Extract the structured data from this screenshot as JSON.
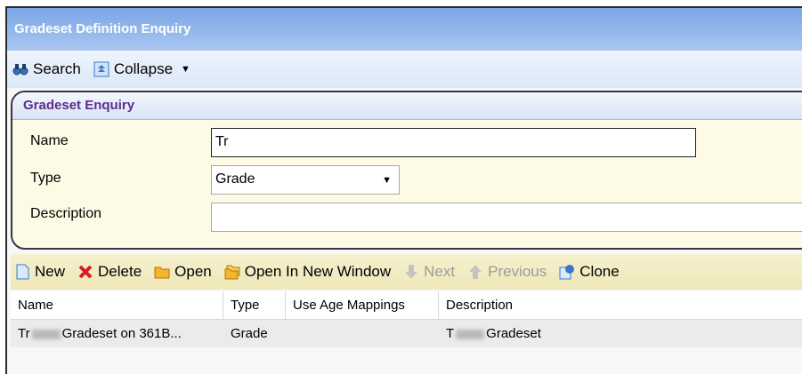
{
  "window": {
    "title": "Gradeset Definition Enquiry"
  },
  "toolbar": {
    "search_label": "Search",
    "collapse_label": "Collapse"
  },
  "panel": {
    "title": "Gradeset Enquiry",
    "name_label": "Name",
    "name_value": "Tr",
    "type_label": "Type",
    "type_value": "Grade",
    "description_label": "Description",
    "description_value": ""
  },
  "actions": {
    "new": "New",
    "delete": "Delete",
    "open": "Open",
    "open_new_window": "Open In New Window",
    "next": "Next",
    "previous": "Previous",
    "clone": "Clone"
  },
  "grid": {
    "columns": [
      "Name",
      "Type",
      "Use Age Mappings",
      "Description"
    ],
    "rows": [
      {
        "name_prefix": "Tr",
        "name_suffix": "Gradeset on 361B...",
        "type": "Grade",
        "use_age_mappings": "",
        "desc_prefix": "T",
        "desc_suffix": "Gradeset"
      }
    ]
  },
  "colors": {
    "title_bar": "#7aa6e6",
    "panel_bg": "#fdfbe5",
    "panel_title": "#5a2d91"
  }
}
